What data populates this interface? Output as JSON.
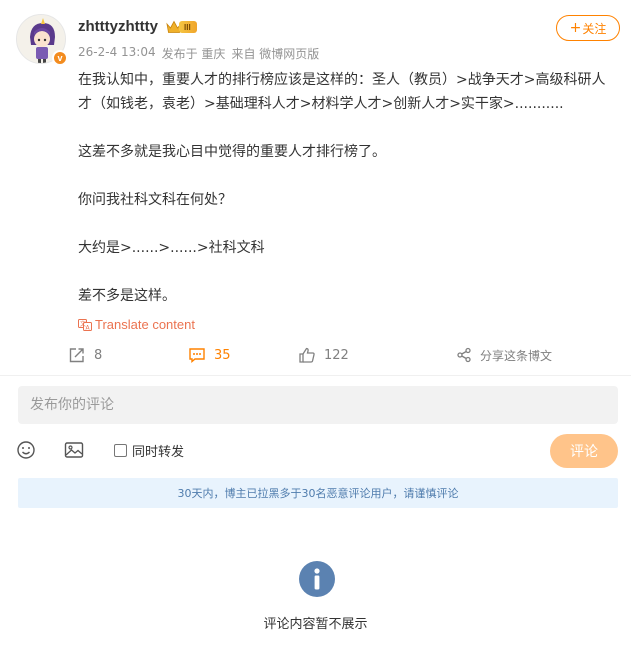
{
  "post": {
    "username": "zhtttyzhttty",
    "level": "III",
    "avatar_badge": "v",
    "meta": {
      "time": "26-2-4 13:04",
      "location": "发布于 重庆",
      "source": "来自 微博网页版"
    },
    "follow_label": "关注",
    "follow_plus": "+",
    "content": [
      "在我认知中，重要人才的排行榜应该是这样的：圣人（教员）>战争天才>高级科研人才（如钱老，袁老）>基础理科人才>材料学人才>创新人才>实干家>...........",
      "这差不多就是我心目中觉得的重要人才排行榜了。",
      "你问我社科文科在何处？",
      "大约是>......>......>社科文科",
      "差不多是这样。"
    ],
    "translate_label": "Translate content",
    "actions": {
      "repost_count": "8",
      "comment_count": "35",
      "like_count": "122",
      "share_label": "分享这条博文"
    }
  },
  "comment_form": {
    "placeholder": "发布你的评论",
    "repost_label": "同时转发",
    "submit_label": "评论",
    "notice": "30天内，博主已拉黑多于30名恶意评论用户，请谨慎评论"
  },
  "comments_empty_text": "评论内容暂不展示",
  "colors": {
    "accent": "#ff8200",
    "submit_disabled": "#ffc48a",
    "notice_bg": "#e8f3fd",
    "info_icon": "#5b82b1"
  }
}
